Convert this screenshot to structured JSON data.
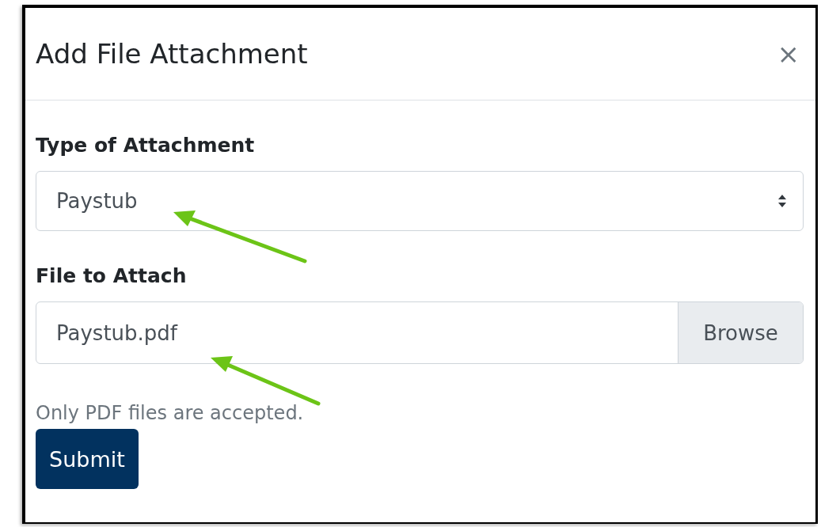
{
  "dialog": {
    "title": "Add File Attachment",
    "close": "×"
  },
  "attachment_type": {
    "label": "Type of Attachment",
    "value": "Paystub"
  },
  "file": {
    "label": "File to Attach",
    "value": "Paystub.pdf",
    "button": "Browse",
    "help": "Only PDF files are accepted."
  },
  "submit": "Submit"
}
